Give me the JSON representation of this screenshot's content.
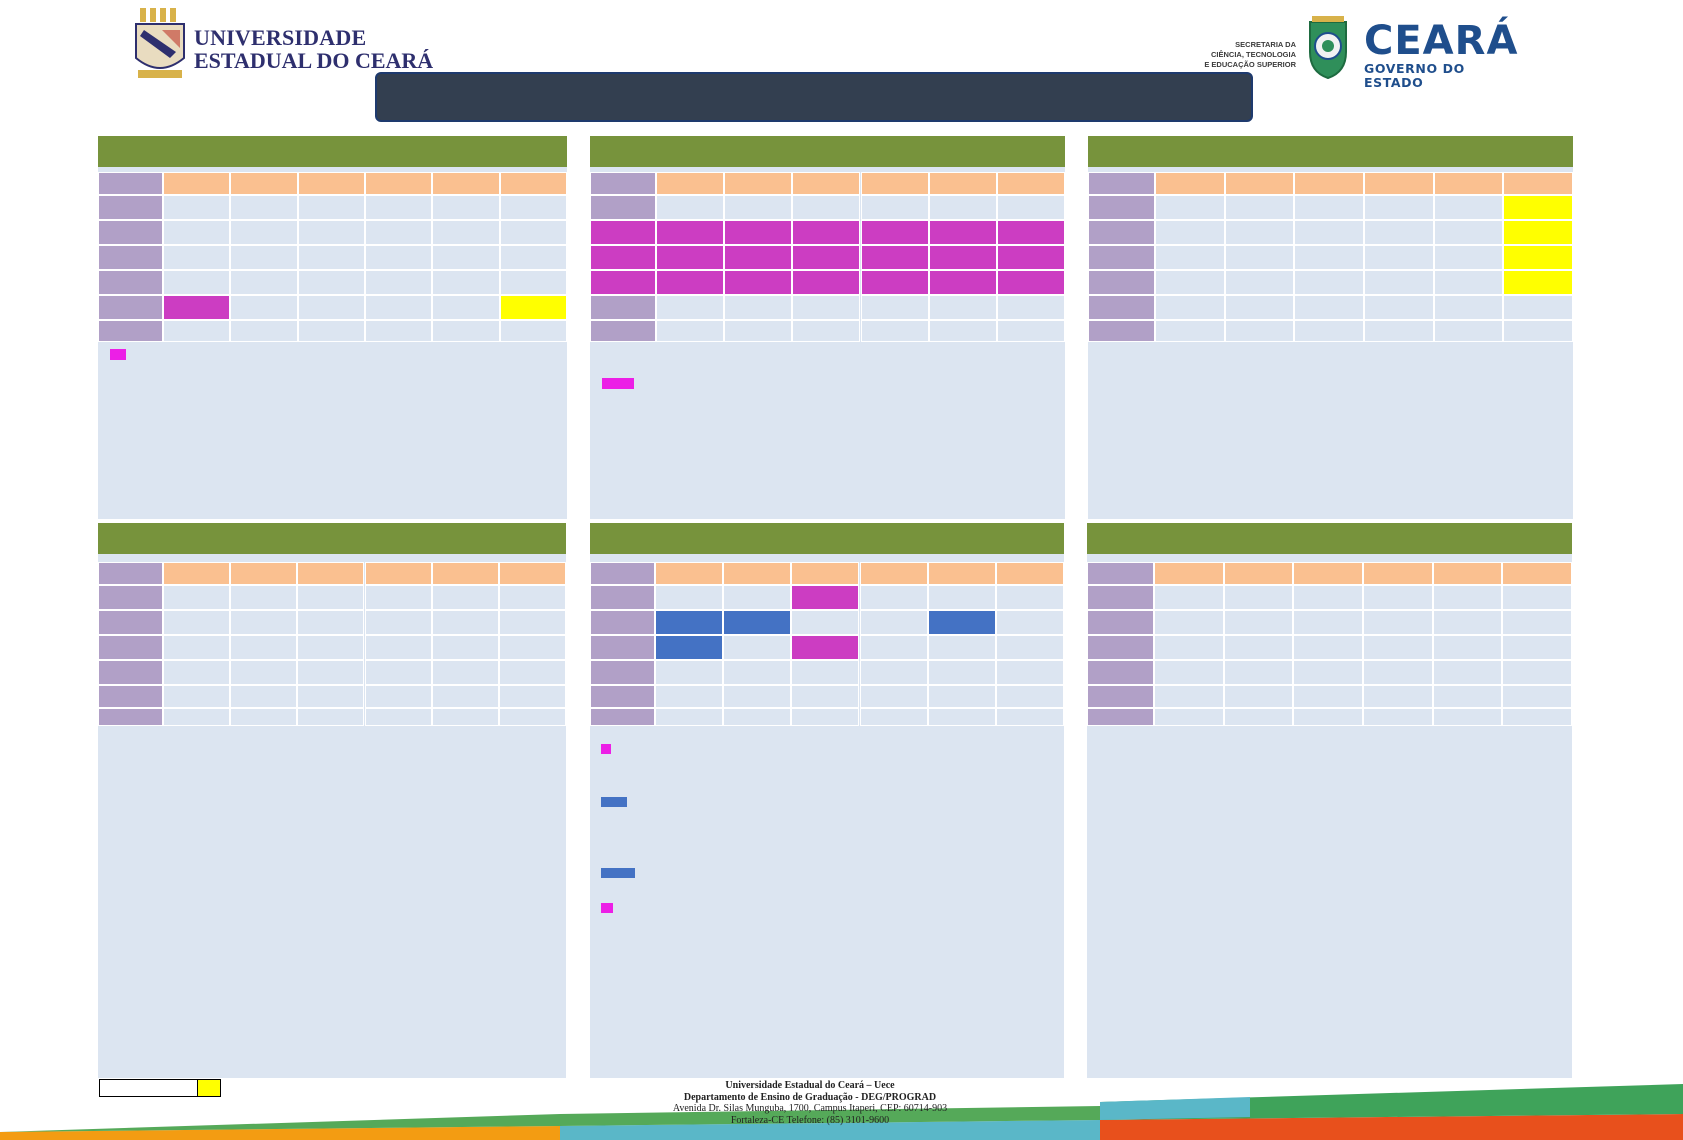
{
  "header": {
    "university_line1": "UNIVERSIDADE",
    "university_line2": "ESTADUAL DO CEARÁ",
    "secretaria_line1": "SECRETARIA DA",
    "secretaria_line2": "CIÊNCIA, TECNOLOGIA",
    "secretaria_line3": "E EDUCAÇÃO SUPERIOR",
    "state_name": "CEARÁ",
    "state_subtitle": "GOVERNO DO ESTADO",
    "title": ""
  },
  "colors": {
    "panel_header": "#77933c",
    "column_header": "#fac090",
    "row_header": "#b1a0c7",
    "cell": "#dce5f1",
    "magenta": "#cc3dc2",
    "yellow": "#ffff00",
    "blue": "#4472c4",
    "title_bar": "#333f50"
  },
  "schedule_panels": [
    {
      "highlights": [
        [
          4,
          0,
          "magenta"
        ],
        [
          4,
          5,
          "yellow"
        ]
      ],
      "legend": [
        "magenta"
      ]
    },
    {
      "highlights": [
        [
          1,
          0,
          "magenta"
        ],
        [
          1,
          1,
          "magenta"
        ],
        [
          1,
          2,
          "magenta"
        ],
        [
          1,
          3,
          "magenta"
        ],
        [
          1,
          4,
          "magenta"
        ],
        [
          1,
          5,
          "magenta"
        ],
        [
          2,
          0,
          "magenta"
        ],
        [
          2,
          1,
          "magenta"
        ],
        [
          2,
          2,
          "magenta"
        ],
        [
          2,
          3,
          "magenta"
        ],
        [
          2,
          4,
          "magenta"
        ],
        [
          2,
          5,
          "magenta"
        ],
        [
          3,
          0,
          "magenta"
        ],
        [
          3,
          1,
          "magenta"
        ],
        [
          3,
          2,
          "magenta"
        ],
        [
          3,
          3,
          "magenta"
        ],
        [
          3,
          4,
          "magenta"
        ],
        [
          3,
          5,
          "magenta"
        ]
      ],
      "row_header_highlights": [
        [
          2,
          "magenta"
        ],
        [
          3,
          "magenta"
        ],
        [
          4,
          "magenta"
        ]
      ],
      "legend": [
        "magenta"
      ]
    },
    {
      "highlights": [
        [
          0,
          5,
          "yellow"
        ],
        [
          1,
          5,
          "yellow"
        ],
        [
          2,
          5,
          "yellow"
        ],
        [
          3,
          5,
          "yellow"
        ]
      ],
      "legend": []
    },
    {
      "highlights": [],
      "legend": []
    },
    {
      "highlights": [
        [
          0,
          2,
          "magenta"
        ],
        [
          1,
          0,
          "blue"
        ],
        [
          1,
          1,
          "blue"
        ],
        [
          1,
          4,
          "blue"
        ],
        [
          2,
          0,
          "blue"
        ],
        [
          2,
          2,
          "magenta"
        ]
      ],
      "legend": [
        "magenta",
        "blue",
        "blue",
        "magenta"
      ]
    },
    {
      "highlights": [],
      "legend": []
    }
  ],
  "footer": {
    "line1": "Universidade Estadual do Ceará – Uece",
    "line2": "Departamento de Ensino de Graduação - DEG/PROGRAD",
    "line3": "Avenida Dr. Silas Munguba, 1700, Campus Itaperi, CEP: 60714-903",
    "line4": "Fortaleza-CE Telefone: (85) 3101-9600"
  }
}
